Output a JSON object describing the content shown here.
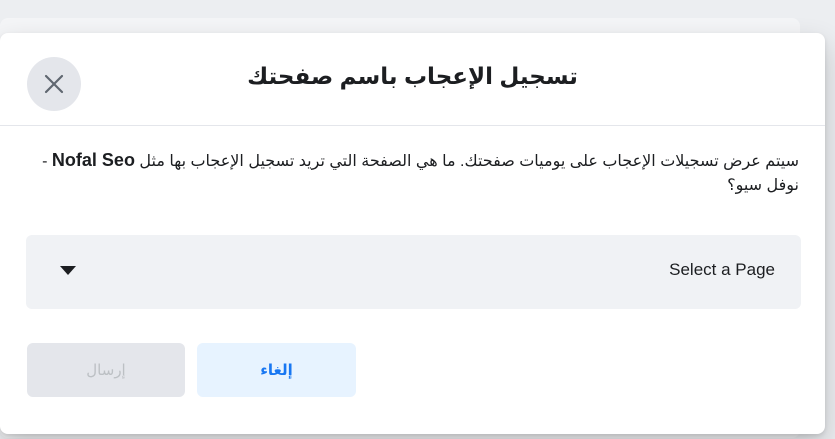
{
  "dialog": {
    "title": "تسجيل الإعجاب باسم صفحتك",
    "close_icon": "close-icon",
    "description_part1": "سيتم عرض تسجيلات الإعجاب على يوميات صفحتك. ما هي الصفحة التي تريد تسجيل الإعجاب بها مثل ",
    "description_page_name": "Nofal Seo",
    "description_part2": " - نوفل سيو؟",
    "select_placeholder": "Select a Page",
    "caret_icon": "caret-down-icon",
    "cancel_label": "إلغاء",
    "send_label": "إرسال",
    "colors": {
      "accent": "#1877f2",
      "cancel_bg": "#e7f3ff",
      "disabled_bg": "#e4e6eb",
      "disabled_text": "#bcc0c4"
    }
  }
}
